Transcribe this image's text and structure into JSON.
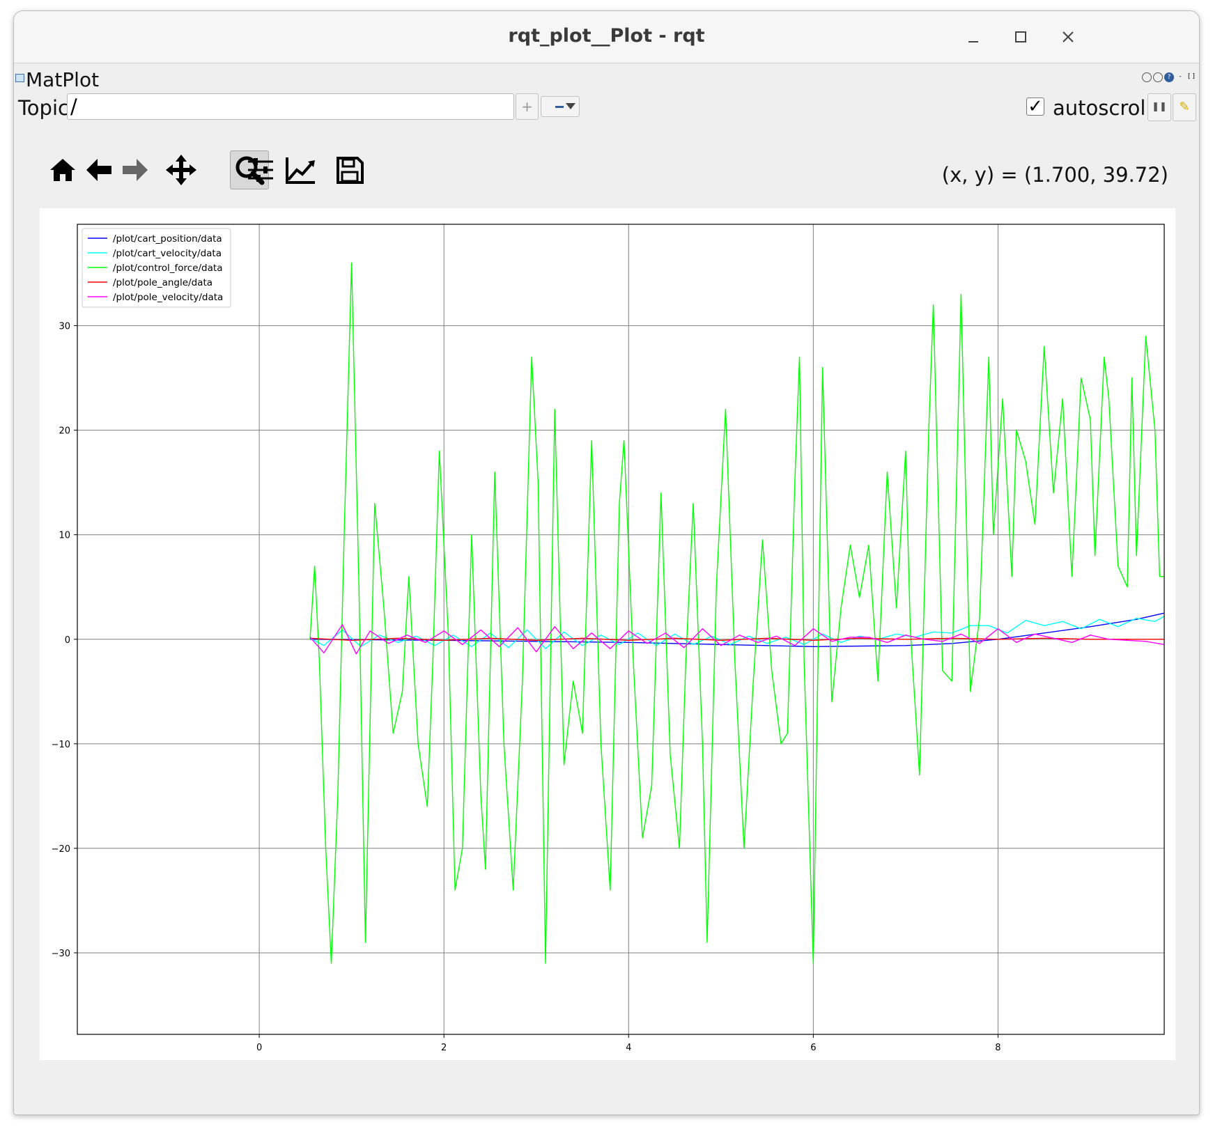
{
  "window": {
    "title": "rqt_plot__Plot - rqt",
    "controls": [
      "minimize-icon",
      "maximize-icon",
      "close-icon"
    ]
  },
  "plugin": {
    "title": "MatPlot"
  },
  "topic": {
    "label": "Topic",
    "value": "/",
    "add_icon": "plus-icon",
    "remove_icon": "minus-dropdown-icon"
  },
  "autoscroll": {
    "label": "autoscroll",
    "checked": true
  },
  "toolbar": {
    "buttons": [
      "home-icon",
      "back-icon",
      "forward-icon",
      "pan-icon",
      "zoom-icon",
      "configure-subplots-icon",
      "edit-axes-icon",
      "save-icon"
    ],
    "active": "zoom-icon",
    "coords": "(x, y) = (1.700, 39.72)"
  },
  "chart_data": {
    "type": "line",
    "title": "",
    "xlabel": "",
    "ylabel": "",
    "xlim": [
      -1.97,
      9.8
    ],
    "ylim": [
      -37.8,
      39.7
    ],
    "xticks": [
      0,
      2,
      4,
      6,
      8
    ],
    "xtick_labels": [
      "0",
      "2",
      "4",
      "6",
      "8"
    ],
    "yticks": [
      -30,
      -20,
      -10,
      0,
      10,
      20,
      30
    ],
    "ytick_labels": [
      "−30",
      "−20",
      "−10",
      "0",
      "10",
      "20",
      "30"
    ],
    "grid": true,
    "legend_position": "top-left",
    "series": [
      {
        "name": "/plot/cart_position/data",
        "color": "#0000ff",
        "x": [
          0.55,
          2.0,
          3.0,
          4.0,
          5.0,
          6.0,
          7.0,
          7.5,
          8.0,
          8.5,
          9.0,
          9.5,
          9.8
        ],
        "y": [
          0.0,
          -0.1,
          -0.2,
          -0.3,
          -0.5,
          -0.7,
          -0.6,
          -0.4,
          0.0,
          0.6,
          1.2,
          1.9,
          2.5
        ]
      },
      {
        "name": "/plot/cart_velocity/data",
        "color": "#00ffff",
        "x": [
          0.55,
          0.7,
          0.9,
          1.1,
          1.3,
          1.5,
          1.7,
          1.9,
          2.1,
          2.3,
          2.5,
          2.7,
          2.9,
          3.1,
          3.3,
          3.5,
          3.7,
          3.9,
          4.1,
          4.3,
          4.5,
          4.7,
          4.9,
          5.1,
          5.3,
          5.5,
          5.7,
          5.9,
          6.1,
          6.3,
          6.5,
          6.7,
          6.9,
          7.1,
          7.3,
          7.5,
          7.7,
          7.9,
          8.1,
          8.3,
          8.5,
          8.7,
          8.9,
          9.1,
          9.3,
          9.5,
          9.7,
          9.8
        ],
        "y": [
          0.1,
          -0.6,
          0.9,
          -0.7,
          0.4,
          -0.3,
          0.3,
          -0.6,
          0.4,
          -0.7,
          0.6,
          -0.8,
          0.9,
          -0.9,
          0.7,
          -0.6,
          0.4,
          -0.5,
          0.6,
          -0.6,
          0.5,
          -0.5,
          0.3,
          -0.5,
          0.3,
          -0.4,
          0.2,
          -0.5,
          0.5,
          -0.3,
          0.3,
          0.0,
          0.5,
          0.2,
          0.7,
          0.6,
          1.3,
          1.3,
          0.6,
          1.8,
          1.3,
          1.7,
          1.0,
          1.9,
          1.2,
          2.0,
          1.7,
          2.2
        ]
      },
      {
        "name": "/plot/control_force/data",
        "color": "#00ff00",
        "x": [
          0.55,
          0.6,
          0.65,
          0.72,
          0.78,
          0.85,
          0.92,
          1.0,
          1.08,
          1.15,
          1.25,
          1.35,
          1.45,
          1.55,
          1.62,
          1.72,
          1.82,
          1.88,
          1.95,
          2.05,
          2.12,
          2.2,
          2.3,
          2.4,
          2.45,
          2.55,
          2.65,
          2.75,
          2.85,
          2.95,
          3.02,
          3.1,
          3.2,
          3.3,
          3.4,
          3.5,
          3.6,
          3.7,
          3.8,
          3.9,
          3.95,
          4.05,
          4.15,
          4.25,
          4.35,
          4.45,
          4.55,
          4.62,
          4.7,
          4.8,
          4.85,
          4.95,
          5.05,
          5.15,
          5.25,
          5.35,
          5.45,
          5.55,
          5.65,
          5.72,
          5.8,
          5.85,
          5.9,
          6.0,
          6.1,
          6.2,
          6.3,
          6.4,
          6.5,
          6.6,
          6.7,
          6.8,
          6.9,
          7.0,
          7.05,
          7.15,
          7.25,
          7.3,
          7.4,
          7.5,
          7.6,
          7.7,
          7.8,
          7.9,
          7.95,
          8.05,
          8.15,
          8.2,
          8.3,
          8.4,
          8.5,
          8.6,
          8.7,
          8.8,
          8.9,
          9.0,
          9.05,
          9.15,
          9.2,
          9.3,
          9.4,
          9.45,
          9.5,
          9.6,
          9.7,
          9.75,
          9.8
        ],
        "y": [
          0.0,
          7.0,
          -2.0,
          -20.0,
          -31.0,
          -15.0,
          10.0,
          36.0,
          5.0,
          -29.0,
          13.0,
          3.0,
          -9.0,
          -5.0,
          6.0,
          -10.0,
          -16.0,
          -2.0,
          18.0,
          0.0,
          -24.0,
          -20.0,
          10.0,
          -15.0,
          -22.0,
          16.0,
          -10.0,
          -24.0,
          -4.0,
          27.0,
          15.0,
          -31.0,
          22.0,
          -12.0,
          -4.0,
          -9.0,
          19.0,
          -10.0,
          -24.0,
          13.0,
          19.0,
          -2.0,
          -19.0,
          -14.0,
          14.0,
          -11.0,
          -20.0,
          -2.0,
          13.0,
          -10.0,
          -29.0,
          5.0,
          22.0,
          -2.0,
          -20.0,
          -4.0,
          9.5,
          -3.0,
          -10.0,
          -9.0,
          15.0,
          27.0,
          -2.0,
          -31.0,
          26.0,
          -6.0,
          3.0,
          9.0,
          4.0,
          9.0,
          -4.0,
          16.0,
          3.0,
          18.0,
          1.0,
          -13.0,
          20.0,
          32.0,
          -3.0,
          -4.0,
          33.0,
          -5.0,
          2.0,
          27.0,
          10.0,
          23.0,
          6.0,
          20.0,
          17.0,
          11.0,
          28.0,
          14.0,
          23.0,
          6.0,
          25.0,
          21.0,
          8.0,
          27.0,
          23.0,
          7.0,
          5.0,
          25.0,
          8.0,
          29.0,
          20.0,
          6.0,
          6.0
        ]
      },
      {
        "name": "/plot/pole_angle/data",
        "color": "#ff0000",
        "x": [
          0.55,
          1.0,
          1.5,
          2.0,
          2.5,
          3.0,
          3.5,
          4.0,
          4.5,
          5.0,
          5.5,
          6.0,
          6.5,
          7.0,
          7.5,
          8.0,
          8.5,
          9.0,
          9.5,
          9.8
        ],
        "y": [
          0.1,
          -0.1,
          0.1,
          -0.1,
          0.1,
          -0.1,
          0.1,
          -0.1,
          0.1,
          -0.1,
          0.1,
          -0.1,
          0.1,
          0.0,
          0.1,
          0.0,
          0.1,
          0.0,
          0.0,
          0.0
        ]
      },
      {
        "name": "/plot/pole_velocity/data",
        "color": "#ff00ff",
        "x": [
          0.55,
          0.7,
          0.9,
          1.05,
          1.2,
          1.4,
          1.6,
          1.8,
          2.0,
          2.2,
          2.4,
          2.6,
          2.8,
          3.0,
          3.2,
          3.4,
          3.6,
          3.8,
          4.0,
          4.2,
          4.4,
          4.6,
          4.8,
          5.0,
          5.2,
          5.4,
          5.6,
          5.8,
          6.0,
          6.2,
          6.4,
          6.6,
          6.8,
          7.0,
          7.2,
          7.4,
          7.6,
          7.8,
          8.0,
          8.2,
          8.4,
          8.6,
          8.8,
          9.0,
          9.2,
          9.4,
          9.6,
          9.8
        ],
        "y": [
          0.2,
          -1.3,
          1.4,
          -1.4,
          0.8,
          -0.4,
          0.4,
          -0.3,
          0.8,
          -0.5,
          0.9,
          -0.7,
          1.1,
          -1.2,
          1.2,
          -0.9,
          0.6,
          -0.9,
          0.8,
          -0.4,
          0.6,
          -0.8,
          1.0,
          -0.6,
          0.4,
          -0.3,
          0.3,
          -0.6,
          1.0,
          -0.2,
          0.2,
          0.2,
          -0.3,
          0.4,
          0.0,
          -0.2,
          0.5,
          -0.4,
          1.0,
          -0.3,
          0.5,
          0.1,
          -0.3,
          0.4,
          0.0,
          -0.1,
          -0.2,
          -0.5
        ]
      }
    ]
  }
}
